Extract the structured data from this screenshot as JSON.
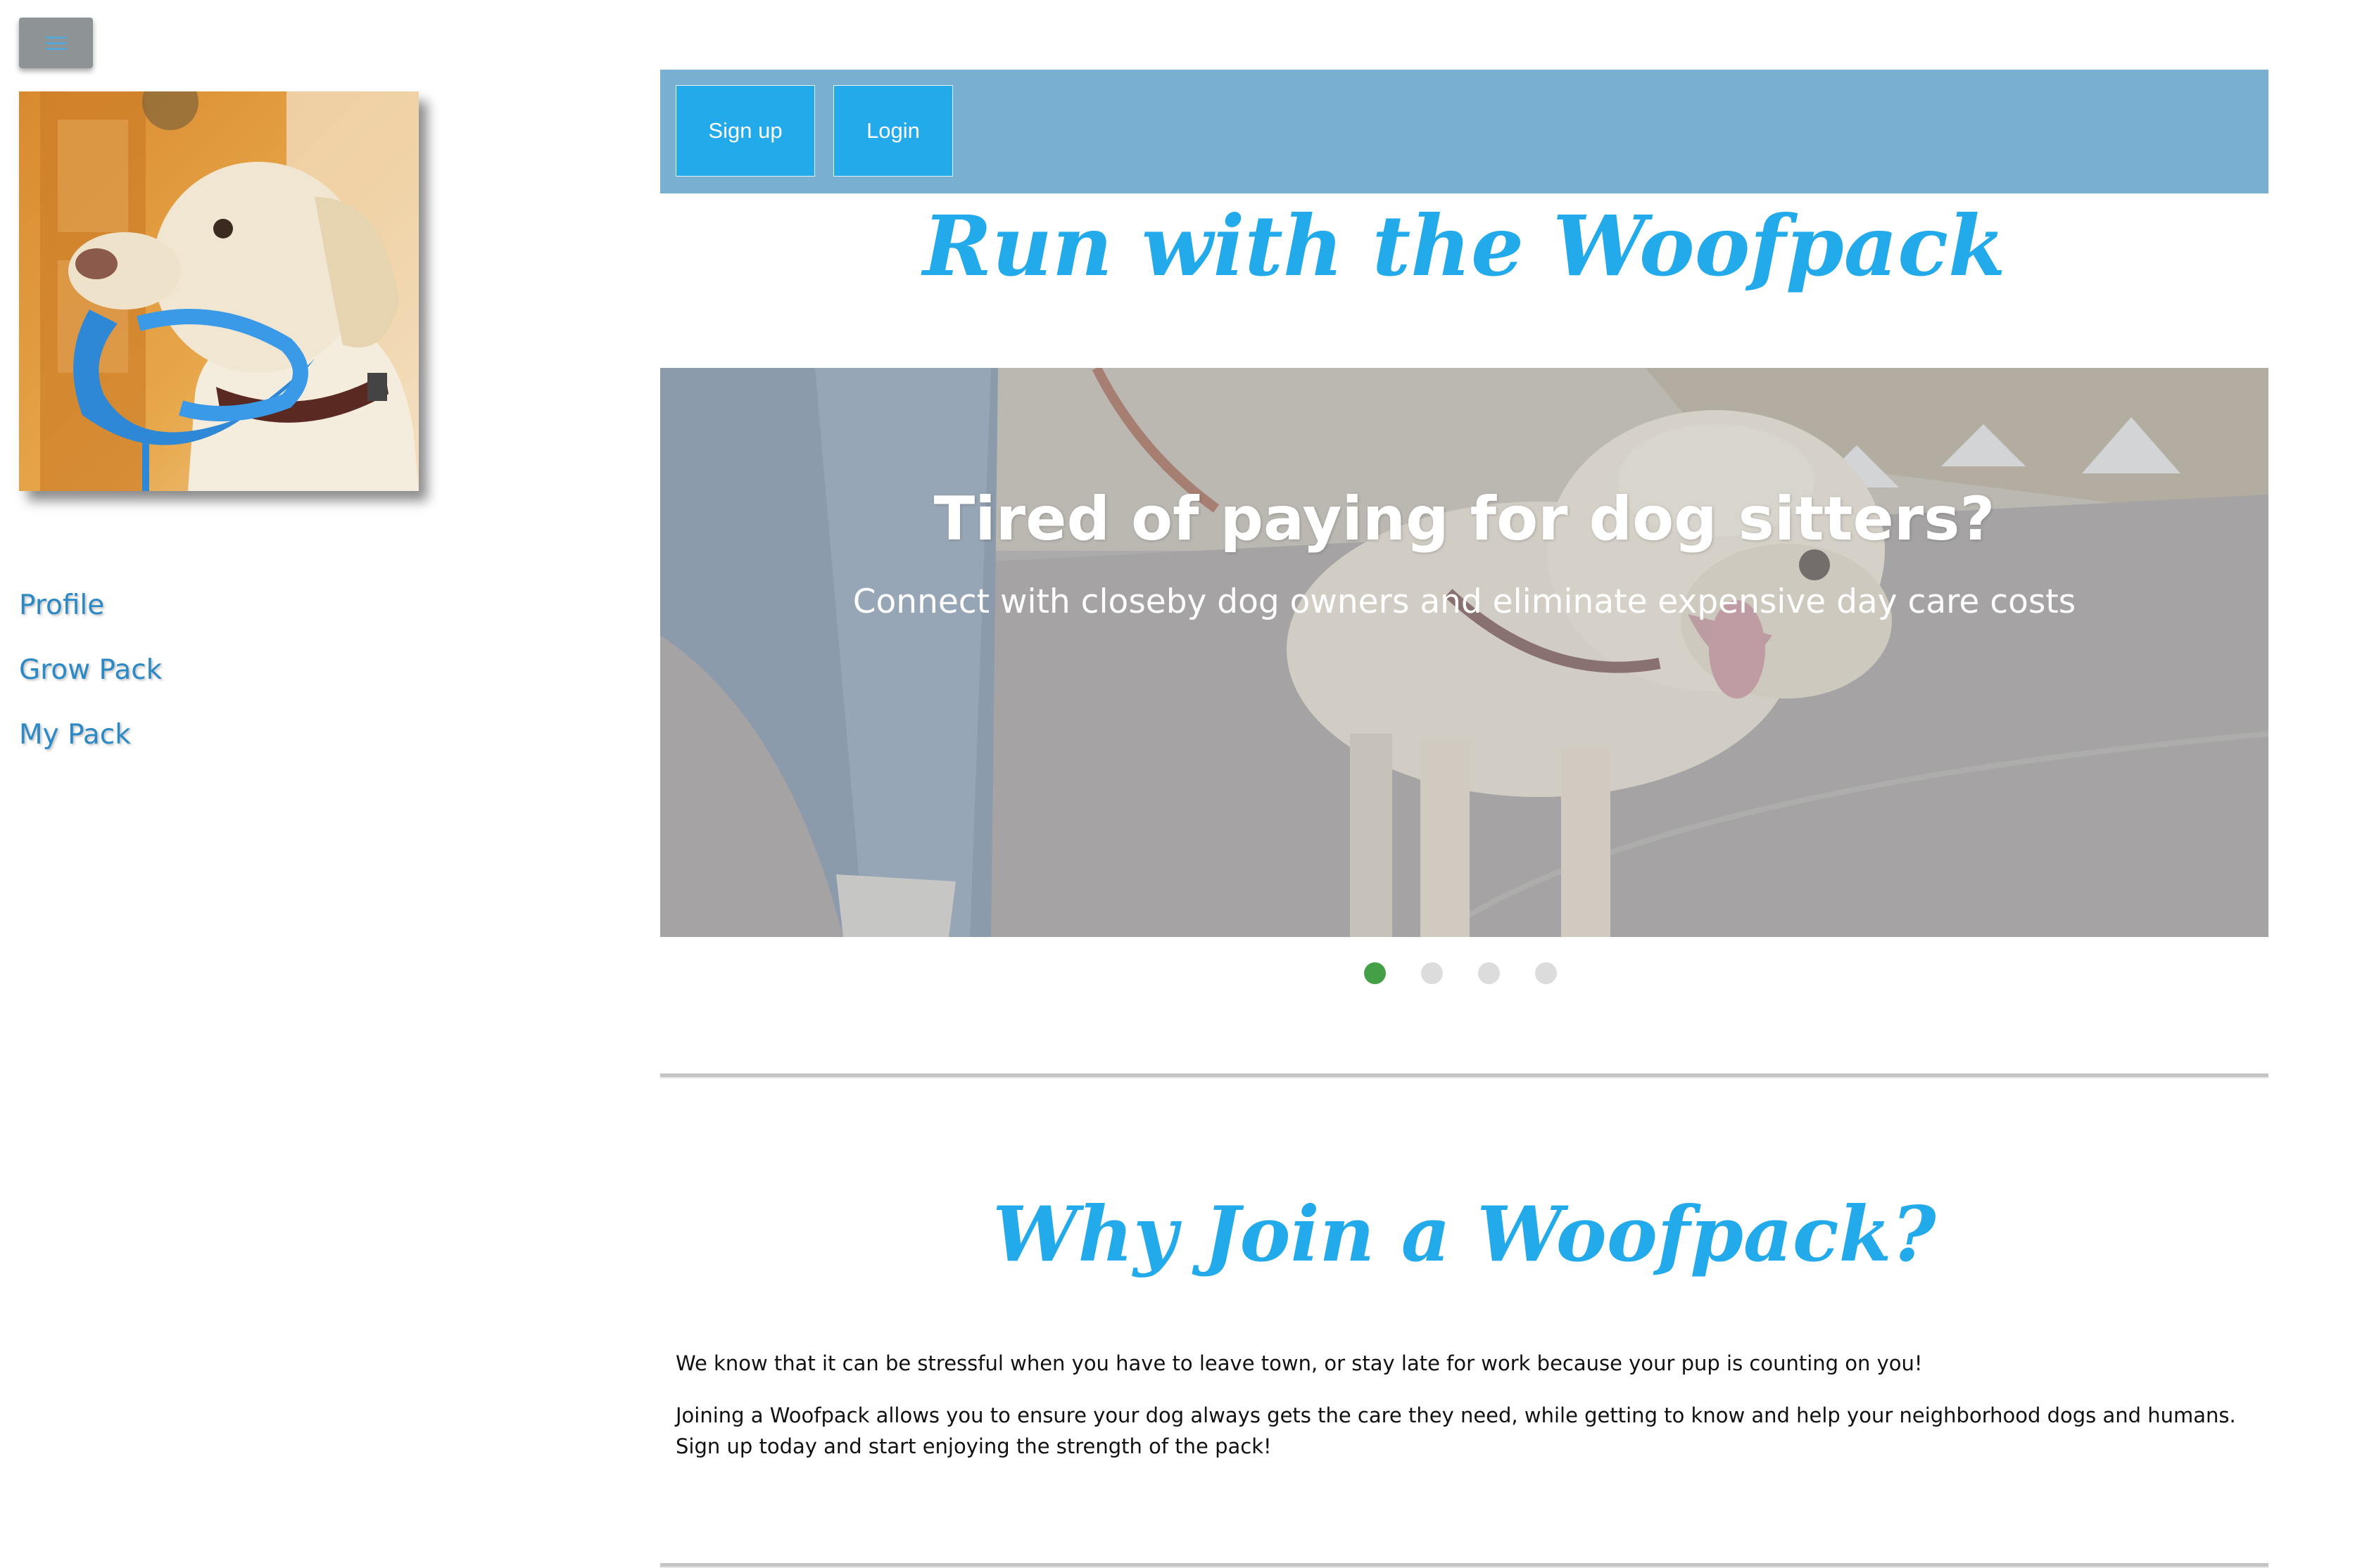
{
  "sidebar": {
    "menu_icon": "hamburger-menu-icon",
    "avatar_alt": "dog-with-leash",
    "nav_items": [
      {
        "label": "Profile"
      },
      {
        "label": "Grow Pack"
      },
      {
        "label": "My Pack"
      }
    ]
  },
  "header": {
    "signup_label": "Sign up",
    "login_label": "Login"
  },
  "hero": {
    "title": "Run with the Woofpack"
  },
  "carousel": {
    "heading": "Tired of paying for dog sitters?",
    "text": "Connect with closeby dog owners and eliminate expensive day care costs",
    "slide_count": 4,
    "active_index": 0
  },
  "why": {
    "title": "Why Join a Woofpack?",
    "paragraph1": "We know that it can be stressful when you have to leave town, or stay late for work because your pup is counting on you!",
    "paragraph2": "Joining a Woofpack allows you to ensure your dog always gets the care they need, while getting to know and help your neighborhood dogs and humans. Sign up today and start enjoying the strength of the pack!"
  },
  "colors": {
    "accent": "#22aaeb",
    "topbar": "#79afd1",
    "nav_link": "#2b89c6",
    "active_dot": "#43a047"
  }
}
